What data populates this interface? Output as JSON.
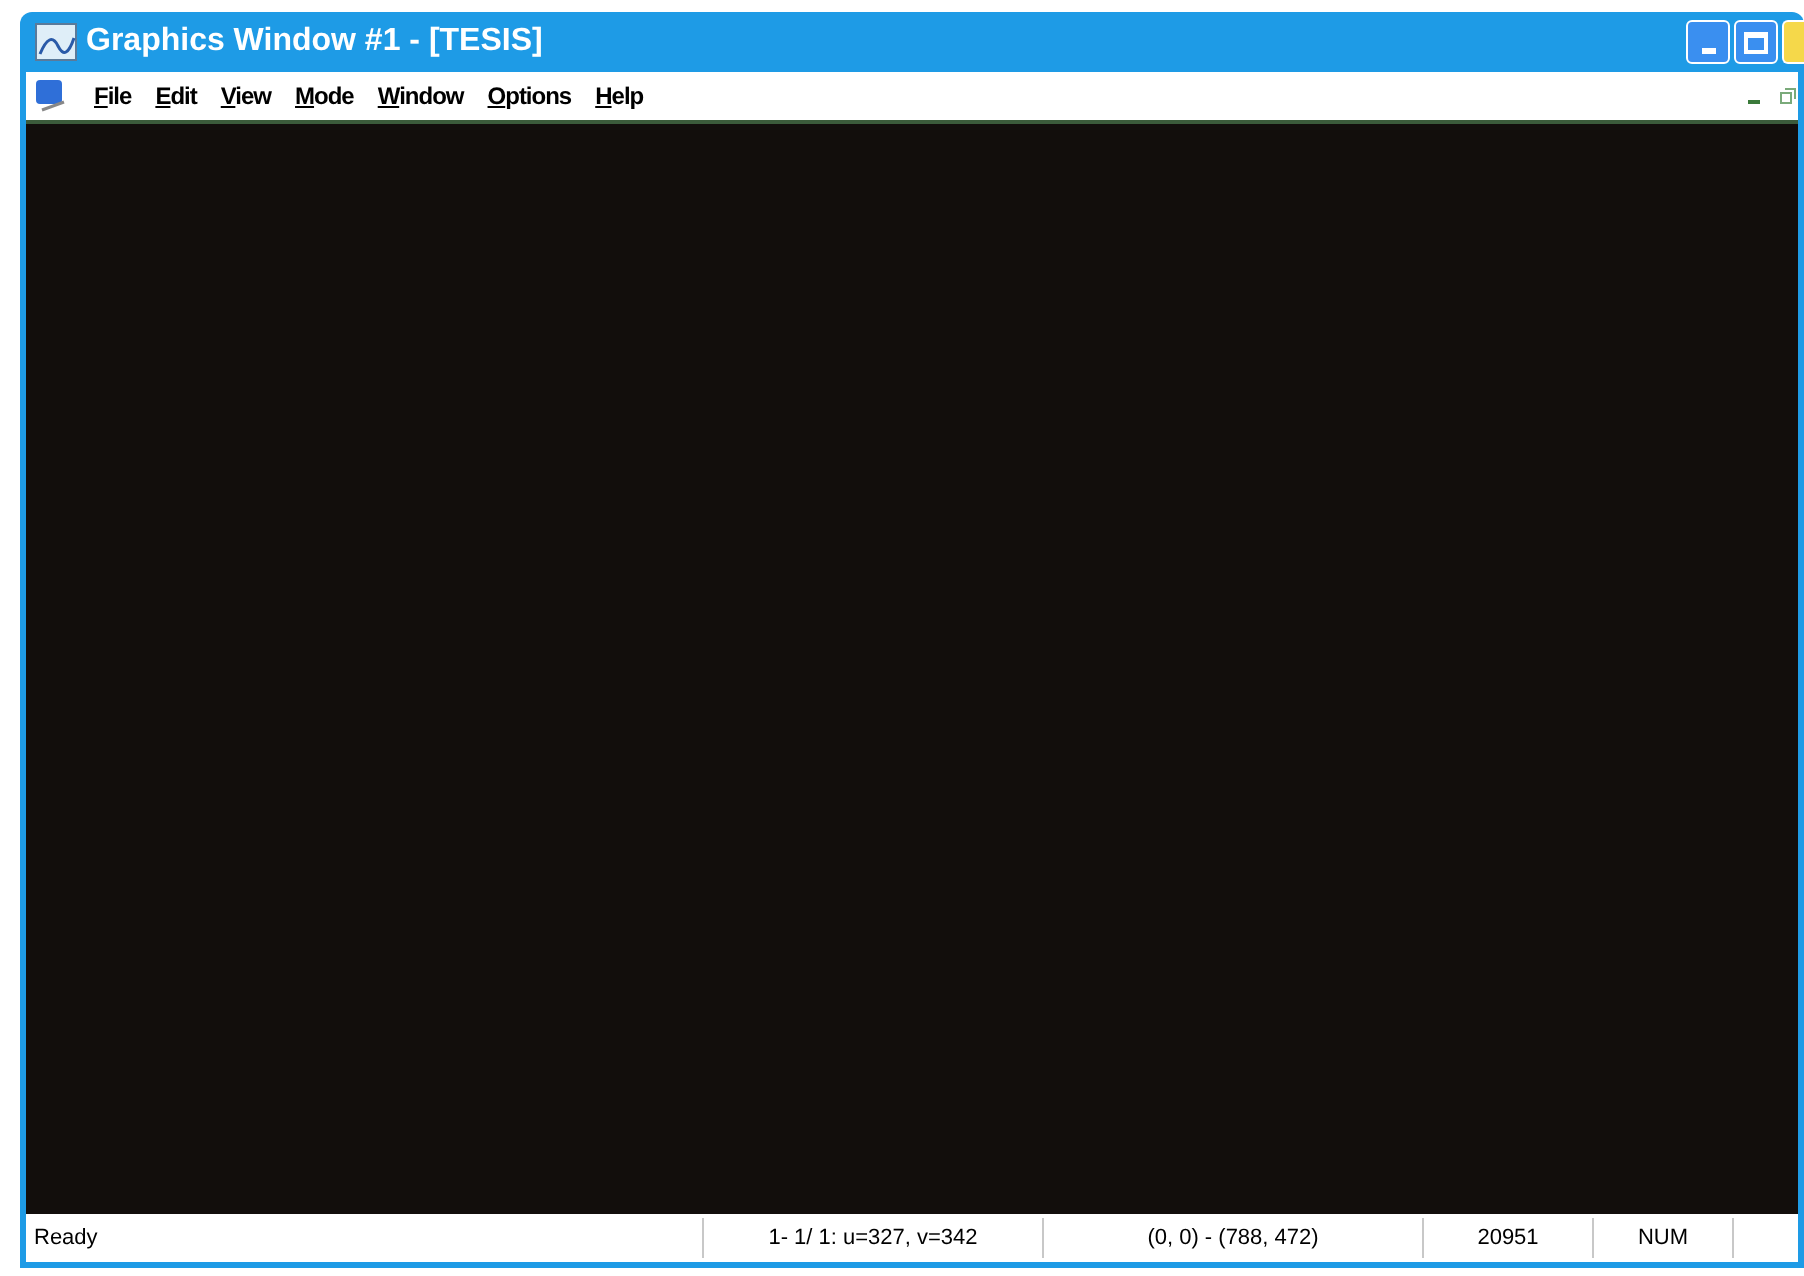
{
  "window": {
    "title": "Graphics Window #1 - [TESIS]"
  },
  "menu": [
    "File",
    "Edit",
    "View",
    "Mode",
    "Window",
    "Options",
    "Help"
  ],
  "status_bar": [
    "Ready",
    "1- 1/ 1: u=327, v=342",
    "(0, 0) - (788, 472)",
    "20951",
    "NUM"
  ]
}
